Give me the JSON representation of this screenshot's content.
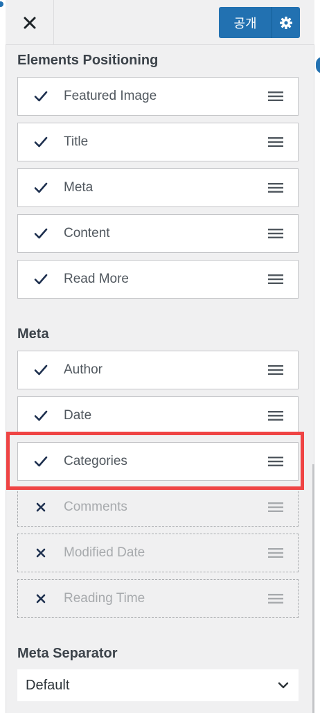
{
  "header": {
    "close_icon": "close-icon",
    "publish_label": "공개",
    "settings_icon": "gear-icon"
  },
  "sections": {
    "positioning": {
      "title": "Elements Positioning",
      "items": [
        {
          "label": "Featured Image",
          "enabled": true
        },
        {
          "label": "Title",
          "enabled": true
        },
        {
          "label": "Meta",
          "enabled": true
        },
        {
          "label": "Content",
          "enabled": true
        },
        {
          "label": "Read More",
          "enabled": true
        }
      ]
    },
    "meta": {
      "title": "Meta",
      "items": [
        {
          "label": "Author",
          "enabled": true
        },
        {
          "label": "Date",
          "enabled": true
        },
        {
          "label": "Categories",
          "enabled": true
        },
        {
          "label": "Comments",
          "enabled": false
        },
        {
          "label": "Modified Date",
          "enabled": false
        },
        {
          "label": "Reading Time",
          "enabled": false
        }
      ]
    },
    "separator": {
      "title": "Meta Separator",
      "selected": "Default"
    }
  },
  "colors": {
    "accent": "#2271b1",
    "highlight": "#ef4444",
    "check": "#1d2f4e"
  }
}
